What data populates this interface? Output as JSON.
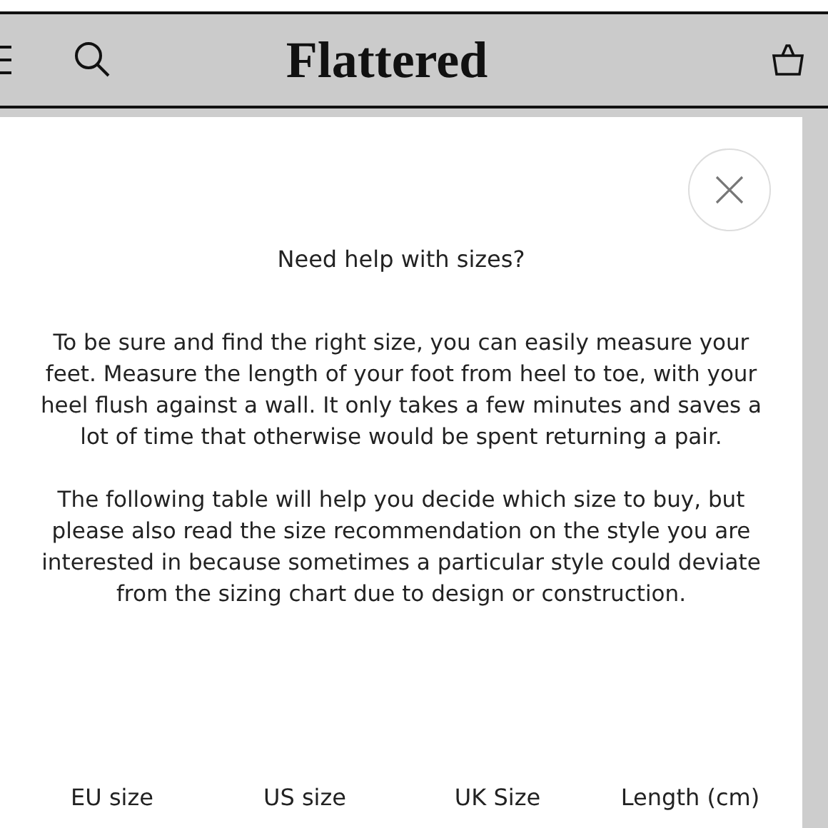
{
  "header": {
    "logo": "Flattered"
  },
  "modal": {
    "title": "Need help with sizes?",
    "paragraphs": [
      "To be sure and find the right size, you can easily measure your feet. Measure the length of your foot from heel to toe, with your heel flush against a wall. It only takes a few minutes and saves a lot of time that otherwise would be spent returning a pair.",
      "The following table will help you decide which size to buy, but please also read the size recommendation on the style you are interested in because sometimes a particular style could deviate from the sizing chart due to design or construction."
    ],
    "table": {
      "columns": [
        "EU size",
        "US size",
        "UK Size",
        "Length (cm)"
      ]
    }
  }
}
